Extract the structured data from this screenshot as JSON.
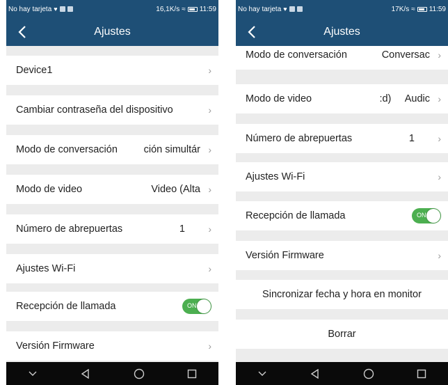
{
  "left": {
    "status": {
      "carrier": "No hay tarjeta",
      "speed": "16,1K/s",
      "time": "11:59"
    },
    "title": "Ajustes",
    "rows": {
      "device": {
        "label": "Device1"
      },
      "password": {
        "label": "Cambiar contraseña del dispositivo"
      },
      "talk_mode": {
        "label": "Modo de conversación",
        "value": "ción simultár"
      },
      "video_mode": {
        "label": "Modo de video",
        "value": "Video (Alta"
      },
      "door_count": {
        "label": "Número de abrepuertas",
        "value": "1"
      },
      "wifi": {
        "label": "Ajustes Wi-Fi"
      },
      "call_reception": {
        "label": "Recepción de llamada",
        "toggle": "ON"
      },
      "firmware": {
        "label": "Versión Firmware"
      }
    }
  },
  "right": {
    "status": {
      "carrier": "No hay tarjeta",
      "speed": "17K/s",
      "time": "11:59"
    },
    "title": "Ajustes",
    "rows": {
      "talk_mode": {
        "label": "Modo de conversación",
        "value": "Conversac"
      },
      "video_mode": {
        "label": "Modo de video",
        "value": ":d)     Audic"
      },
      "door_count": {
        "label": "Número de abrepuertas",
        "value": "1"
      },
      "wifi": {
        "label": "Ajustes Wi-Fi"
      },
      "call_reception": {
        "label": "Recepción de llamada",
        "toggle": "ON"
      },
      "firmware": {
        "label": "Versión Firmware"
      },
      "sync_datetime": {
        "label": "Sincronizar fecha y hora en monitor"
      },
      "delete": {
        "label": "Borrar"
      }
    }
  },
  "colors": {
    "header": "#1e4f76",
    "toggle_on": "#4caf50",
    "page_bg": "#ececec",
    "navbar": "#0a0a0a"
  },
  "icons": {
    "back": "chevron-left-icon",
    "row": "chevron-right-icon",
    "nav": [
      "hide-keyboard-icon",
      "back-triangle-icon",
      "home-circle-icon",
      "recents-square-icon"
    ]
  }
}
